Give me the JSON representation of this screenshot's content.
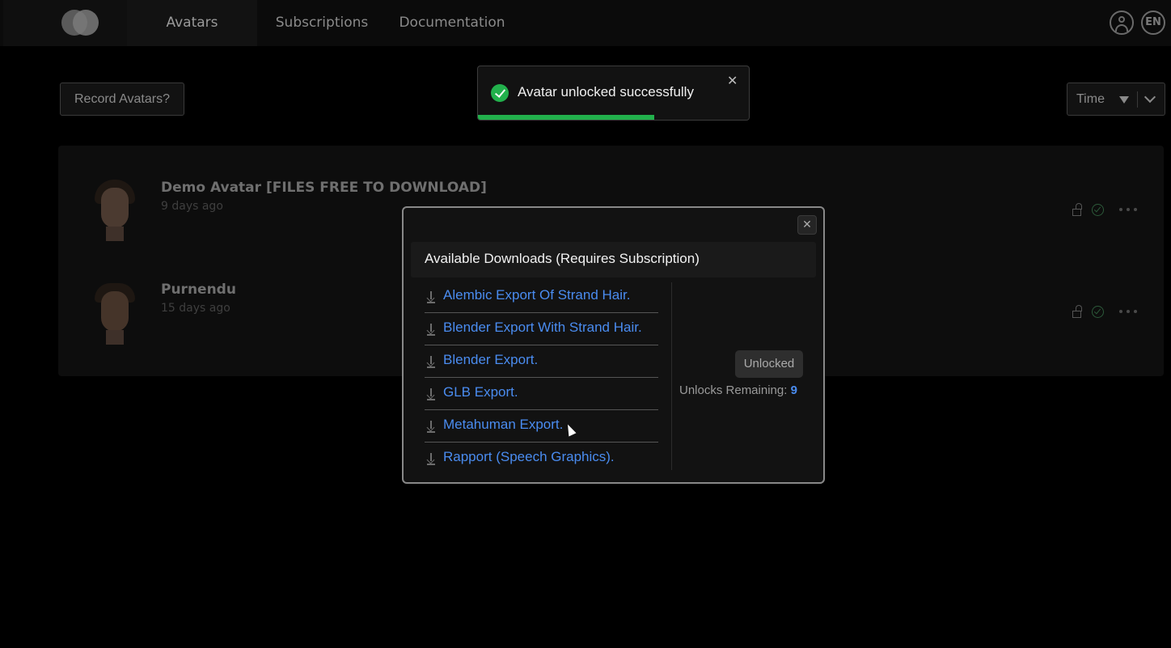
{
  "nav": {
    "tabs": [
      {
        "label": "Avatars",
        "active": true
      },
      {
        "label": "Subscriptions",
        "active": false
      },
      {
        "label": "Documentation",
        "active": false
      }
    ],
    "language": "EN",
    "icons": {
      "logo": "logo-icon",
      "user": "user-icon"
    }
  },
  "toolbar": {
    "record_label": "Record Avatars?",
    "sort_label": "Time"
  },
  "avatars": [
    {
      "name": "Demo Avatar [FILES FREE TO DOWNLOAD]",
      "time": "9 days ago"
    },
    {
      "name": "Purnendu",
      "time": "15 days ago"
    }
  ],
  "toast": {
    "message": "Avatar unlocked successfully",
    "progress": 0.65,
    "accent": "#22b14c"
  },
  "modal": {
    "title": "Available Downloads (Requires Subscription)",
    "downloads": [
      "Alembic Export Of Strand Hair.",
      "Blender Export With Strand Hair.",
      "Blender Export.",
      "GLB Export.",
      "Metahuman Export.",
      "Rapport (Speech Graphics)."
    ],
    "status_label": "Unlocked",
    "unlocks_label": "Unlocks Remaining:",
    "unlocks_value": "9",
    "link_color": "#4a8cf0"
  }
}
